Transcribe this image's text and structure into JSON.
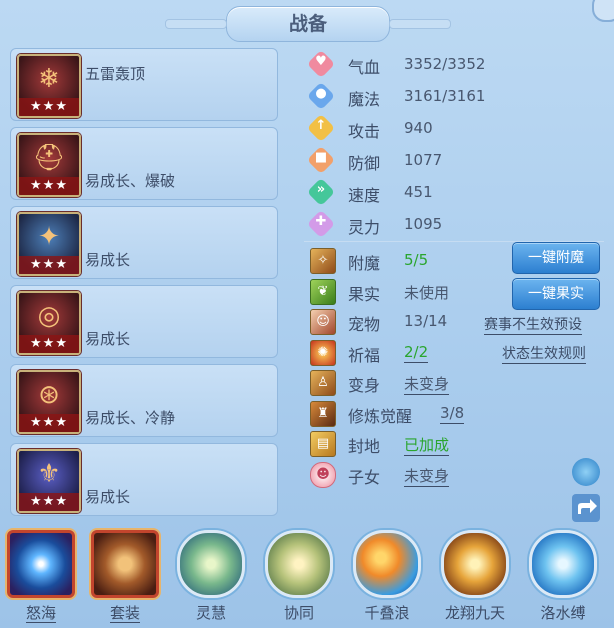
{
  "title": "战备",
  "equipment": [
    {
      "name": "五雷轰顶",
      "stars": "★★★",
      "icon": "ice-pop-icon"
    },
    {
      "name": "易成长、爆破",
      "stars": "★★★",
      "icon": "red-helmet-icon"
    },
    {
      "name": "易成长",
      "stars": "★★★",
      "icon": "blue-mask-icon"
    },
    {
      "name": "易成长",
      "stars": "★★★",
      "icon": "gold-necklace-icon"
    },
    {
      "name": "易成长、冷静",
      "stars": "★★★",
      "icon": "red-belt-icon"
    },
    {
      "name": "易成长",
      "stars": "★★★",
      "icon": "blue-armor-icon"
    }
  ],
  "stats": [
    {
      "label": "气血",
      "value": "3352/3352",
      "icon": "heart-icon",
      "color": "#f08a9f"
    },
    {
      "label": "魔法",
      "value": "3161/3161",
      "icon": "mana-icon",
      "color": "#6aa7ec"
    },
    {
      "label": "攻击",
      "value": "940",
      "icon": "attack-icon",
      "color": "#f2c045"
    },
    {
      "label": "防御",
      "value": "1077",
      "icon": "defense-icon",
      "color": "#f2a06a"
    },
    {
      "label": "速度",
      "value": "451",
      "icon": "speed-icon",
      "color": "#45c79a"
    },
    {
      "label": "灵力",
      "value": "1095",
      "icon": "spirit-icon",
      "color": "#d39be8"
    }
  ],
  "attrs": [
    {
      "label": "附魔",
      "value": "5/5",
      "green": true,
      "underline": false
    },
    {
      "label": "果实",
      "value": "未使用",
      "green": false,
      "underline": false
    },
    {
      "label": "宠物",
      "value": "13/14",
      "green": false,
      "underline": false
    },
    {
      "label": "祈福",
      "value": "2/2",
      "green": true,
      "underline": true
    },
    {
      "label": "变身",
      "value": "未变身",
      "green": false,
      "underline": true
    },
    {
      "label": "修炼觉醒",
      "value": "3/8",
      "green": false,
      "underline": true
    },
    {
      "label": "封地",
      "value": "已加成",
      "green": true,
      "underline": true
    },
    {
      "label": "子女",
      "value": "未变身",
      "green": false,
      "underline": true
    }
  ],
  "buttons": {
    "enchant": "一键附魔",
    "fruit": "一键果实"
  },
  "links": {
    "preset": "赛事不生效预设",
    "rules": "状态生效规则"
  },
  "bottom": [
    {
      "label": "怒海",
      "shape": "square",
      "underline": true
    },
    {
      "label": "套装",
      "shape": "square",
      "underline": true
    },
    {
      "label": "灵慧",
      "shape": "circle",
      "underline": false
    },
    {
      "label": "协同",
      "shape": "circle",
      "underline": false
    },
    {
      "label": "千叠浪",
      "shape": "circle",
      "underline": false
    },
    {
      "label": "龙翔九天",
      "shape": "circle",
      "underline": false
    },
    {
      "label": "洛水缚",
      "shape": "circle",
      "underline": false
    }
  ]
}
